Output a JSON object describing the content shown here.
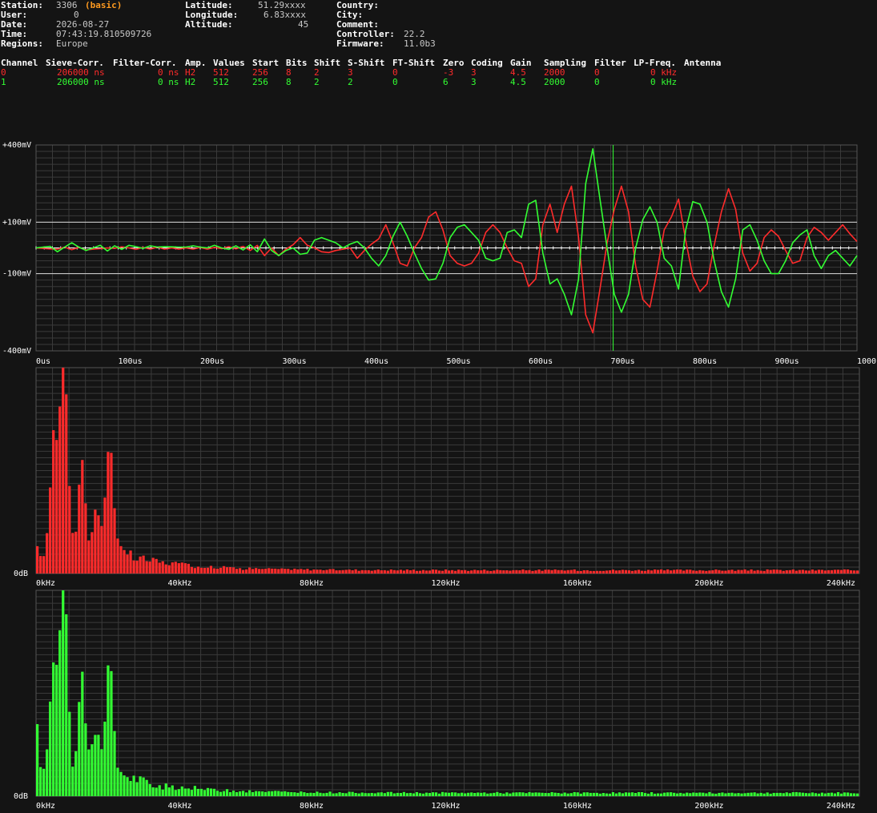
{
  "header": {
    "station_label": "Station:",
    "station_value": "3306",
    "station_mode": "(basic)",
    "user_label": "User:",
    "user_value": "0",
    "date_label": "Date:",
    "date_value": "2026-08-27",
    "time_label": "Time:",
    "time_value": "07:43:19.810509726",
    "regions_label": "Regions:",
    "regions_value": "Europe",
    "latitude_label": "Latitude:",
    "latitude_value": "51.29xxxx",
    "longitude_label": "Longitude:",
    "longitude_value": "6.83xxxx",
    "altitude_label": "Altitude:",
    "altitude_value": "45",
    "country_label": "Country:",
    "city_label": "City:",
    "comment_label": "Comment:",
    "controller_label": "Controller:",
    "controller_value": "22.2",
    "firmware_label": "Firmware:",
    "firmware_value": "11.0b3"
  },
  "channel_table": {
    "headers": [
      "Channel",
      "Sieve-Corr.",
      "Filter-Corr.",
      "Amp.",
      "Values",
      "Start",
      "Bits",
      "Shift",
      "S-Shift",
      "FT-Shift",
      "Zero",
      "Coding",
      "Gain",
      "Sampling",
      "Filter",
      "LP-Freq.",
      "Antenna"
    ],
    "rows": [
      {
        "channel": "0",
        "sieve": "206000 ns",
        "filter_corr": "0 ns",
        "amp": "H2",
        "values": "512",
        "start": "256",
        "bits": "8",
        "shift": "2",
        "s_shift": "3",
        "ft_shift": "0",
        "zero": "-3",
        "coding": "3",
        "gain": "4.5",
        "sampling": "2000",
        "filter": "0",
        "lp_freq": "0 kHz",
        "antenna": "",
        "color": "#ff2b2b"
      },
      {
        "channel": "1",
        "sieve": "206000 ns",
        "filter_corr": "0 ns",
        "amp": "H2",
        "values": "512",
        "start": "256",
        "bits": "8",
        "shift": "2",
        "s_shift": "2",
        "ft_shift": "0",
        "zero": "6",
        "coding": "3",
        "gain": "4.5",
        "sampling": "2000",
        "filter": "0",
        "lp_freq": "0 kHz",
        "antenna": "",
        "color": "#33ff33"
      }
    ]
  },
  "chart_data": [
    {
      "type": "line",
      "x_unit": "us",
      "xlim": [
        0,
        1000
      ],
      "ylim": [
        -400,
        400
      ],
      "x_tick_labels": [
        "0us",
        "100us",
        "200us",
        "300us",
        "400us",
        "500us",
        "600us",
        "700us",
        "800us",
        "900us",
        "1000us"
      ],
      "y_tick_labels": [
        {
          "label": "+400mV",
          "value": 400
        },
        {
          "label": "+100mV",
          "value": 100
        },
        {
          "label": "-100mV",
          "value": -100
        },
        {
          "label": "-400mV",
          "value": -400
        }
      ],
      "marker_x": 703,
      "series_colors": [
        "#ff2b2b",
        "#33ff33"
      ],
      "waveform": [
        [
          0,
          0,
          0
        ],
        [
          20,
          -4,
          6
        ],
        [
          30,
          -5,
          -15
        ],
        [
          40,
          3,
          3
        ],
        [
          50,
          -7,
          20
        ],
        [
          60,
          2,
          3
        ],
        [
          70,
          -8,
          -10
        ],
        [
          80,
          -5,
          0
        ],
        [
          90,
          -3,
          10
        ],
        [
          100,
          0,
          -12
        ],
        [
          110,
          -2,
          8
        ],
        [
          120,
          4,
          -6
        ],
        [
          130,
          0,
          10
        ],
        [
          140,
          -6,
          5
        ],
        [
          150,
          2,
          -2
        ],
        [
          160,
          -5,
          8
        ],
        [
          170,
          3,
          3
        ],
        [
          180,
          -5,
          5
        ],
        [
          190,
          0,
          4
        ],
        [
          200,
          -5,
          3
        ],
        [
          210,
          0,
          3
        ],
        [
          220,
          -5,
          8
        ],
        [
          230,
          2,
          3
        ],
        [
          240,
          -5,
          0
        ],
        [
          250,
          2,
          10
        ],
        [
          260,
          -3,
          0
        ],
        [
          270,
          5,
          -6
        ],
        [
          280,
          -4,
          8
        ],
        [
          290,
          6,
          -8
        ],
        [
          300,
          -10,
          12
        ],
        [
          310,
          10,
          -15
        ],
        [
          320,
          -30,
          35
        ],
        [
          330,
          0,
          -10
        ],
        [
          340,
          -30,
          -30
        ],
        [
          350,
          -5,
          -10
        ],
        [
          360,
          12,
          0
        ],
        [
          370,
          40,
          -25
        ],
        [
          380,
          10,
          -20
        ],
        [
          390,
          0,
          30
        ],
        [
          400,
          -15,
          40
        ],
        [
          410,
          -18,
          30
        ],
        [
          420,
          -10,
          20
        ],
        [
          430,
          -5,
          0
        ],
        [
          440,
          0,
          15
        ],
        [
          450,
          -40,
          25
        ],
        [
          460,
          -10,
          0
        ],
        [
          470,
          15,
          -40
        ],
        [
          480,
          35,
          -70
        ],
        [
          490,
          90,
          -30
        ],
        [
          500,
          20,
          45
        ],
        [
          510,
          -60,
          100
        ],
        [
          520,
          -70,
          45
        ],
        [
          530,
          0,
          -20
        ],
        [
          540,
          40,
          -80
        ],
        [
          550,
          120,
          -125
        ],
        [
          560,
          140,
          -120
        ],
        [
          570,
          70,
          -60
        ],
        [
          580,
          -30,
          40
        ],
        [
          590,
          -60,
          80
        ],
        [
          600,
          -70,
          90
        ],
        [
          610,
          -60,
          60
        ],
        [
          620,
          -20,
          30
        ],
        [
          630,
          60,
          -40
        ],
        [
          640,
          90,
          -50
        ],
        [
          650,
          60,
          -40
        ],
        [
          660,
          0,
          60
        ],
        [
          670,
          -50,
          70
        ],
        [
          680,
          -60,
          40
        ],
        [
          690,
          -150,
          170
        ],
        [
          700,
          -120,
          185
        ],
        [
          710,
          90,
          -20
        ],
        [
          720,
          170,
          -140
        ],
        [
          730,
          60,
          -120
        ],
        [
          740,
          170,
          -180
        ],
        [
          750,
          240,
          -260
        ],
        [
          760,
          40,
          -120
        ],
        [
          770,
          -260,
          250
        ],
        [
          780,
          -330,
          385
        ],
        [
          790,
          -160,
          190
        ],
        [
          800,
          20,
          0
        ],
        [
          810,
          150,
          -180
        ],
        [
          820,
          240,
          -250
        ],
        [
          830,
          140,
          -180
        ],
        [
          840,
          -70,
          0
        ],
        [
          850,
          -200,
          110
        ],
        [
          860,
          -230,
          160
        ],
        [
          870,
          -90,
          100
        ],
        [
          880,
          70,
          -40
        ],
        [
          890,
          120,
          -70
        ],
        [
          900,
          190,
          -160
        ],
        [
          910,
          30,
          70
        ],
        [
          920,
          -110,
          180
        ],
        [
          930,
          -170,
          170
        ],
        [
          940,
          -140,
          100
        ],
        [
          950,
          10,
          -50
        ],
        [
          960,
          140,
          -170
        ],
        [
          970,
          230,
          -230
        ],
        [
          980,
          150,
          -120
        ],
        [
          990,
          -20,
          70
        ],
        [
          1000,
          -90,
          90
        ],
        [
          1010,
          -60,
          30
        ],
        [
          1020,
          40,
          -50
        ],
        [
          1030,
          70,
          -100
        ],
        [
          1040,
          45,
          -100
        ],
        [
          1050,
          -10,
          -50
        ],
        [
          1060,
          -60,
          20
        ],
        [
          1070,
          -50,
          50
        ],
        [
          1080,
          40,
          70
        ],
        [
          1090,
          80,
          -30
        ],
        [
          1100,
          60,
          -80
        ],
        [
          1110,
          30,
          -30
        ],
        [
          1120,
          60,
          -10
        ],
        [
          1130,
          90,
          -40
        ],
        [
          1140,
          55,
          -70
        ],
        [
          1150,
          25,
          -30
        ]
      ]
    },
    {
      "type": "bar",
      "x_unit": "kHz",
      "xlim": [
        0,
        250
      ],
      "y_tick_labels": [
        {
          "label": "0dB",
          "value": 0
        }
      ],
      "x_tick_labels": [
        "0kHz",
        "40kHz",
        "80kHz",
        "120kHz",
        "160kHz",
        "200kHz",
        "240kHz"
      ],
      "color": "#ff2b2b",
      "peaks": [
        [
          8.5,
          1.0
        ],
        [
          5.5,
          0.55
        ],
        [
          22.5,
          0.56
        ],
        [
          14,
          0.45
        ],
        [
          18.5,
          0.22
        ]
      ]
    },
    {
      "type": "bar",
      "x_unit": "kHz",
      "xlim": [
        0,
        250
      ],
      "y_tick_labels": [
        {
          "label": "0dB",
          "value": 0
        }
      ],
      "x_tick_labels": [
        "0kHz",
        "40kHz",
        "80kHz",
        "120kHz",
        "160kHz",
        "200kHz",
        "240kHz"
      ],
      "color": "#33ff33",
      "peaks": [
        [
          0.2,
          0.3
        ],
        [
          8.5,
          1.0
        ],
        [
          5.5,
          0.55
        ],
        [
          22.5,
          0.56
        ],
        [
          14,
          0.48
        ],
        [
          18.5,
          0.25
        ]
      ]
    }
  ]
}
